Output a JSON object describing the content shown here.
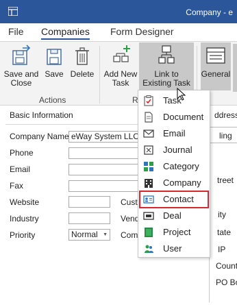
{
  "window": {
    "title": "Company - e"
  },
  "tabs": [
    {
      "label": "File"
    },
    {
      "label": "Companies"
    },
    {
      "label": "Form Designer"
    }
  ],
  "ribbon": {
    "save_and_close": [
      "Save and",
      "Close"
    ],
    "save": "Save",
    "delete": "Delete",
    "add_new_task": [
      "Add New",
      "Task"
    ],
    "link_existing_task": [
      "Link to",
      "Existing Task"
    ],
    "general": "General",
    "groups": {
      "actions": "Actions",
      "r": "R"
    }
  },
  "form": {
    "section_basic": "Basic Information",
    "section_right": "ddress",
    "labels": {
      "company_name": "Company Name",
      "phone": "Phone",
      "email": "Email",
      "fax": "Fax",
      "website": "Website",
      "industry": "Industry",
      "priority": "Priority",
      "custo": "Custo",
      "vendo": "Vendo",
      "comp": "Comp"
    },
    "values": {
      "company_name": "eWay System LLC",
      "priority": "Normal"
    },
    "right_labels": [
      "ling",
      "treet",
      "ity",
      "tate",
      "IP",
      "Countr",
      "PO Box"
    ]
  },
  "menu": {
    "items": [
      {
        "label": "Task",
        "icon": "clipboard-check-icon"
      },
      {
        "label": "Document",
        "icon": "document-icon"
      },
      {
        "label": "Email",
        "icon": "envelope-icon"
      },
      {
        "label": "Journal",
        "icon": "journal-icon"
      },
      {
        "label": "Category",
        "icon": "category-icon"
      },
      {
        "label": "Company",
        "icon": "building-icon"
      },
      {
        "label": "Contact",
        "icon": "contact-card-icon",
        "highlighted": true
      },
      {
        "label": "Deal",
        "icon": "deal-icon"
      },
      {
        "label": "Project",
        "icon": "project-icon"
      },
      {
        "label": "User",
        "icon": "user-icon"
      }
    ]
  },
  "colors": {
    "title_bar": "#2b579a",
    "highlight_border": "#d9262c",
    "ribbon_bg": "#f3f3f3",
    "pressed_button": "#c8c8c8"
  }
}
